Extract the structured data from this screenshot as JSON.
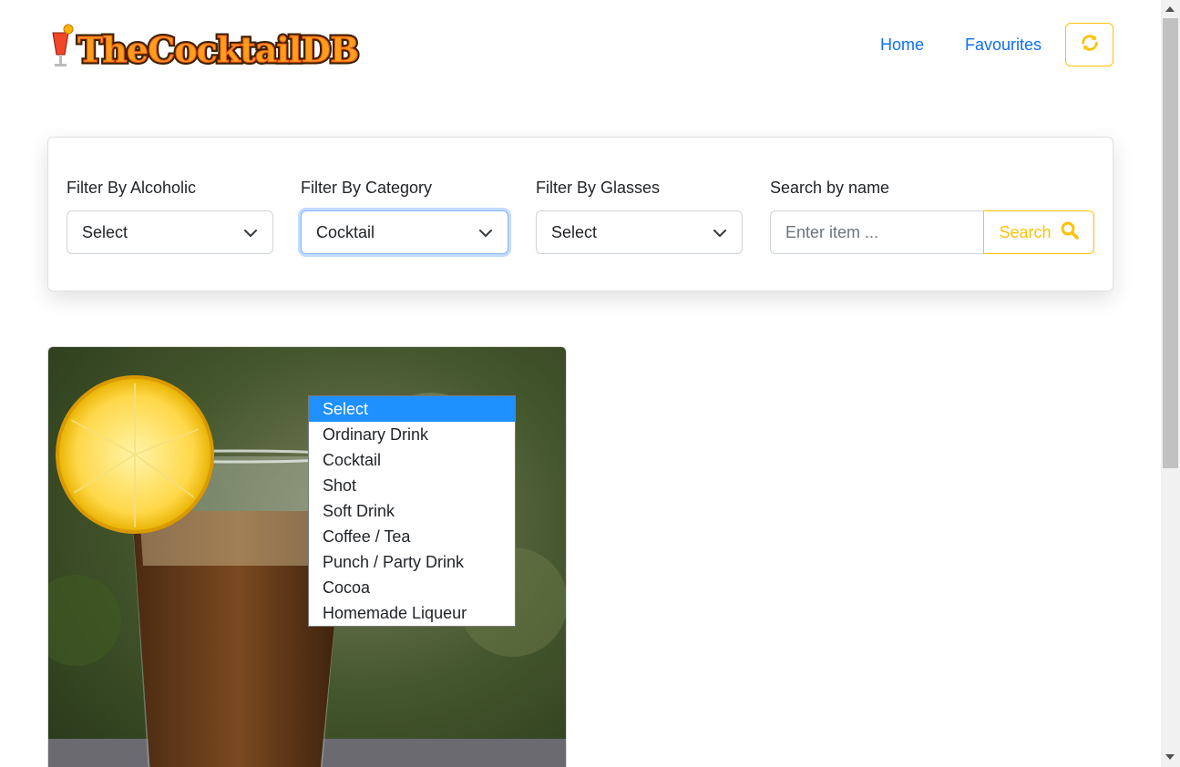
{
  "header": {
    "logo_text": "TheCocktailDB",
    "nav": [
      {
        "label": "Home"
      },
      {
        "label": "Favourites"
      }
    ],
    "refresh_icon": "refresh-icon"
  },
  "filters": {
    "alcoholic": {
      "label": "Filter By Alcoholic",
      "value": "Select"
    },
    "category": {
      "label": "Filter By Category",
      "value": "Cocktail"
    },
    "glasses": {
      "label": "Filter By Glasses",
      "value": "Select"
    },
    "search": {
      "label": "Search by name",
      "placeholder": "Enter item ...",
      "button_label": "Search"
    }
  },
  "category_dropdown": {
    "options": [
      "Select",
      "Ordinary Drink",
      "Cocktail",
      "Shot",
      "Soft Drink",
      "Coffee / Tea",
      "Punch / Party Drink",
      "Cocoa",
      "Homemade Liqueur"
    ],
    "highlighted": "Select"
  },
  "colors": {
    "accent": "#ffc107",
    "link": "#0d6efd",
    "highlight": "#1e90ff"
  }
}
